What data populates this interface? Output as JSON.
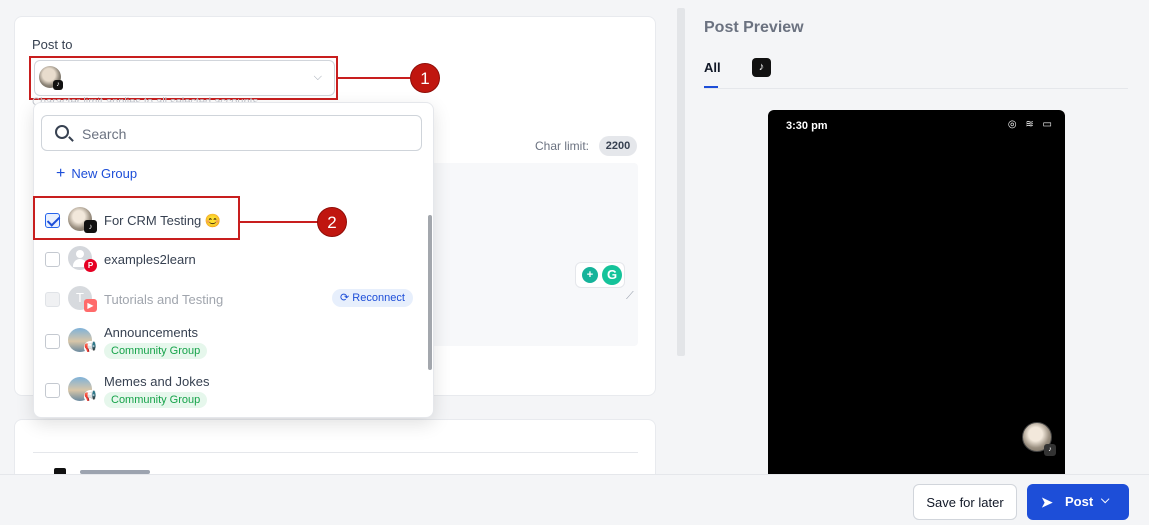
{
  "composer": {
    "post_to_label": "Post to",
    "behind_text": "Character limit applies to all selected accounts",
    "char_limit_label": "Char limit:",
    "char_limit_value": "2200"
  },
  "dropdown": {
    "search_placeholder": "Search",
    "new_group_label": "New Group",
    "items": [
      {
        "name": "For CRM Testing 😊",
        "checked": true,
        "platform": "tiktok"
      },
      {
        "name": "examples2learn",
        "checked": false,
        "platform": "pinterest"
      },
      {
        "name": "Tutorials and Testing",
        "checked": false,
        "platform": "youtube",
        "avatar_letter": "T",
        "action": "Reconnect"
      },
      {
        "name": "Announcements",
        "checked": false,
        "platform": "community",
        "tag": "Community Group"
      },
      {
        "name": "Memes and Jokes",
        "checked": false,
        "platform": "community",
        "tag": "Community Group"
      }
    ]
  },
  "annotations": {
    "step1": "1",
    "step2": "2"
  },
  "preview": {
    "title": "Post Preview",
    "tab_all": "All",
    "tab_tiktok_icon": "tiktok-icon",
    "phone_time": "3:30 pm",
    "phone_status_icons": "◎ ≋ ▭"
  },
  "footer": {
    "save_label": "Save for later",
    "post_label": "Post"
  },
  "colors": {
    "accent": "#1d4ed8",
    "annotation_red": "#c81e1e",
    "community_green": "#16a34a"
  }
}
